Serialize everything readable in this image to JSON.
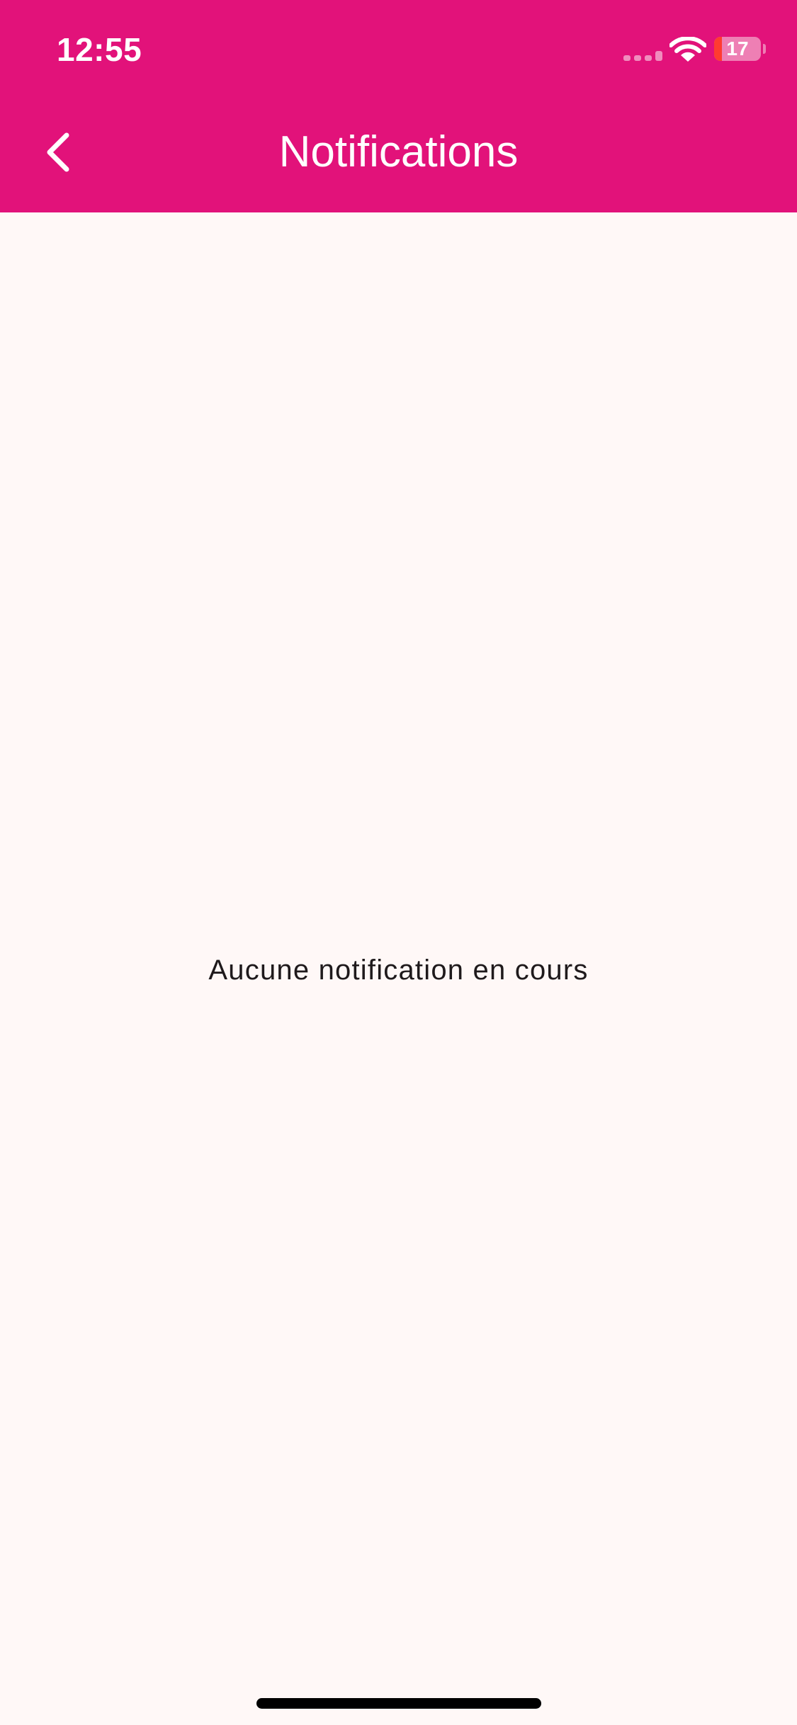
{
  "status_bar": {
    "time": "12:55",
    "battery_level": "17",
    "icons": [
      "cellular-signal-icon",
      "wifi-icon",
      "battery-icon"
    ]
  },
  "header": {
    "title": "Notifications",
    "back_icon": "chevron-left-icon"
  },
  "main": {
    "empty_message": "Aucune notification en cours"
  },
  "colors": {
    "header_background": "#e2127a",
    "page_background": "#fff8f7",
    "text_on_header": "#ffffff",
    "body_text": "#1f1a1c",
    "battery_low": "#ff3b30"
  }
}
